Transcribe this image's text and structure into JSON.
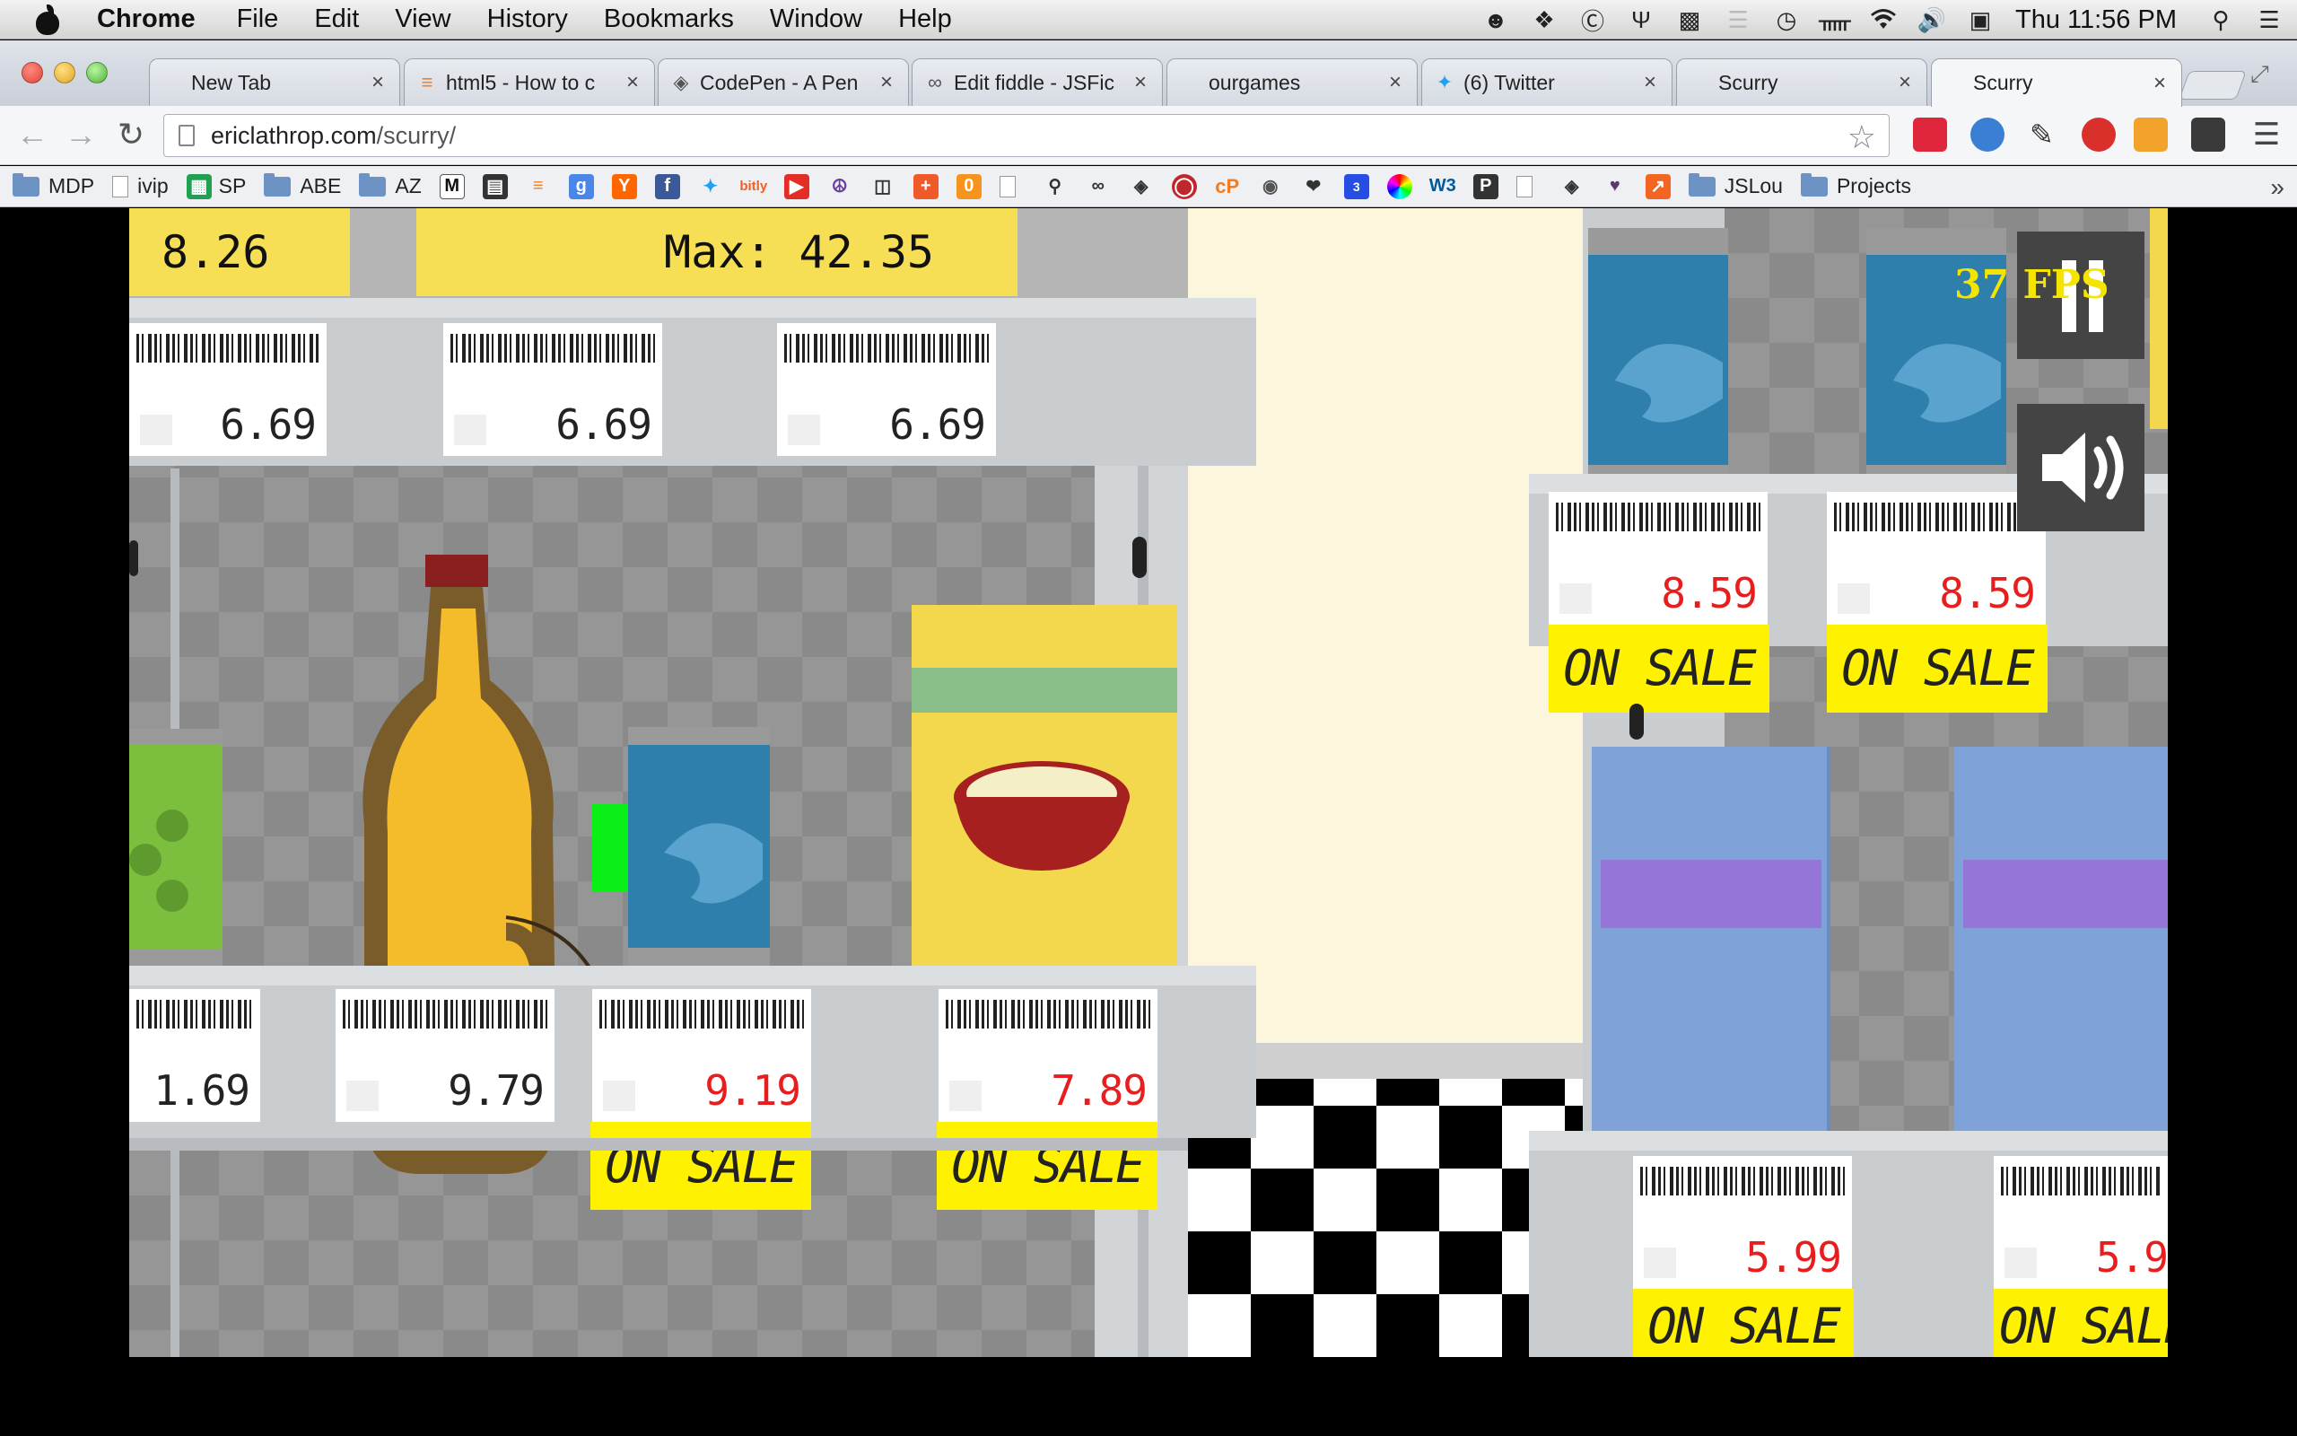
{
  "menubar": {
    "app_name": "Chrome",
    "items": [
      "File",
      "Edit",
      "View",
      "History",
      "Bookmarks",
      "Window",
      "Help"
    ],
    "clock": "Thu 11:56 PM"
  },
  "tabs": [
    {
      "title": "New Tab",
      "icon": "blank-page-icon"
    },
    {
      "title": "html5 - How to c",
      "icon": "stackoverflow-icon"
    },
    {
      "title": "CodePen - A Pen",
      "icon": "codepen-icon"
    },
    {
      "title": "Edit fiddle - JSFic",
      "icon": "jsfiddle-icon"
    },
    {
      "title": "ourgames",
      "icon": "blank-page-icon"
    },
    {
      "title": "(6) Twitter",
      "icon": "twitter-icon"
    },
    {
      "title": "Scurry",
      "icon": "blank-page-icon"
    },
    {
      "title": "Scurry",
      "icon": "blank-page-icon",
      "active": true
    }
  ],
  "address": {
    "domain": "ericlathrop.com",
    "path": "/scurry/"
  },
  "bookmarks": [
    {
      "label": "MDP",
      "type": "folder"
    },
    {
      "label": "ivip",
      "type": "doc"
    },
    {
      "label": "SP",
      "type": "sheets"
    },
    {
      "label": "ABE",
      "type": "folder"
    },
    {
      "label": "AZ",
      "type": "folder"
    }
  ],
  "bookmarks_right": [
    {
      "label": "JSLou",
      "type": "folder"
    },
    {
      "label": "Projects",
      "type": "folder"
    }
  ],
  "game": {
    "hud_score": "8.26",
    "hud_max": "Max: 42.35",
    "fps": "37 FPS",
    "top_tags": [
      "6.69",
      "6.69",
      "6.69"
    ],
    "middle_tags": [
      {
        "price": "1.69",
        "sale": false
      },
      {
        "price": "9.79",
        "sale": false
      },
      {
        "price": "9.19",
        "sale": true
      },
      {
        "price": "7.89",
        "sale": true
      }
    ],
    "right_top_tags": [
      {
        "price": "8.59",
        "sale": true
      },
      {
        "price": "8.59",
        "sale": true
      }
    ],
    "right_bottom_tags": [
      {
        "price": "5.99",
        "sale": true
      },
      {
        "price": "5.9",
        "sale": true
      }
    ],
    "sale_text": "ON SALE",
    "colors": {
      "sale_yellow": "#fef200",
      "sale_price_red": "#e81d1d",
      "hud_yellow": "#f6df55",
      "fps_yellow": "#f5e400"
    }
  }
}
